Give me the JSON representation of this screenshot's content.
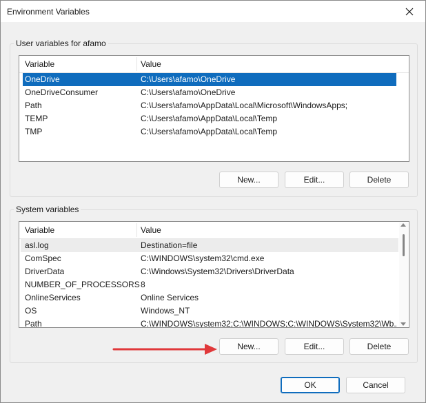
{
  "window": {
    "title": "Environment Variables"
  },
  "user": {
    "label": "User variables for afamo",
    "columns": [
      "Variable",
      "Value"
    ],
    "rows": [
      {
        "name": "OneDrive",
        "value": "C:\\Users\\afamo\\OneDrive"
      },
      {
        "name": "OneDriveConsumer",
        "value": "C:\\Users\\afamo\\OneDrive"
      },
      {
        "name": "Path",
        "value": "C:\\Users\\afamo\\AppData\\Local\\Microsoft\\WindowsApps;"
      },
      {
        "name": "TEMP",
        "value": "C:\\Users\\afamo\\AppData\\Local\\Temp"
      },
      {
        "name": "TMP",
        "value": "C:\\Users\\afamo\\AppData\\Local\\Temp"
      }
    ],
    "buttons": {
      "new": "New...",
      "edit": "Edit...",
      "delete": "Delete"
    }
  },
  "system": {
    "label": "System variables",
    "columns": [
      "Variable",
      "Value"
    ],
    "rows": [
      {
        "name": "asl.log",
        "value": "Destination=file"
      },
      {
        "name": "ComSpec",
        "value": "C:\\WINDOWS\\system32\\cmd.exe"
      },
      {
        "name": "DriverData",
        "value": "C:\\Windows\\System32\\Drivers\\DriverData"
      },
      {
        "name": "NUMBER_OF_PROCESSORS",
        "value": "8"
      },
      {
        "name": "OnlineServices",
        "value": "Online Services"
      },
      {
        "name": "OS",
        "value": "Windows_NT"
      },
      {
        "name": "Path",
        "value": "C:\\WINDOWS\\system32;C:\\WINDOWS;C:\\WINDOWS\\System32\\Wb..."
      }
    ],
    "buttons": {
      "new": "New...",
      "edit": "Edit...",
      "delete": "Delete"
    }
  },
  "footer": {
    "ok": "OK",
    "cancel": "Cancel"
  },
  "colors": {
    "selection": "#0f6cbd",
    "annotation_arrow": "#e0383a"
  }
}
